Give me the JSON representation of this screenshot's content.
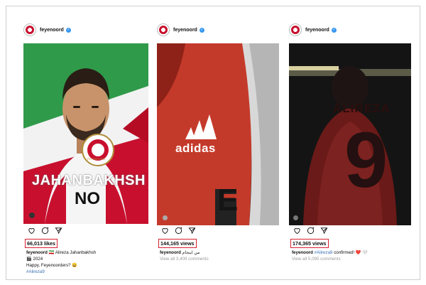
{
  "account": {
    "username": "feyenoord"
  },
  "posts": [
    {
      "id": "post1",
      "stat_text": "66,013 likes",
      "caption_user": "feyenoord",
      "caption_line1": "🇮🇷 Alireza Jahanbakhsh",
      "caption_line2": "🎬 2024",
      "caption_line3": "Happy, Feyenoorders? 😄",
      "caption_hashtag": "#Alireza9",
      "image_text_main": "JAHANBAKHSH",
      "image_text_sub": "NO",
      "image_badge": "FEYENOORD"
    },
    {
      "id": "post2",
      "stat_text": "144,165 views",
      "caption_user": "feyenoord",
      "caption_text": "من اینجام",
      "comments_text": "View all 3,409 comments",
      "image_text_brand": "adidas",
      "image_text_shirt": "E"
    },
    {
      "id": "post3",
      "stat_text": "174,365 views",
      "caption_user": "feyenoord",
      "caption_hashtag": "#Alireza9",
      "caption_text": "confirmed! ❤️ 🤍",
      "comments_text": "View all 5,095 comments",
      "image_text_name": "ALIREZA",
      "image_text_number": "9"
    }
  ],
  "colors": {
    "highlight": "#d8202f",
    "verified": "#3897f0",
    "hashtag": "#3a6fb3",
    "feyenoord_red": "#c8102e"
  }
}
